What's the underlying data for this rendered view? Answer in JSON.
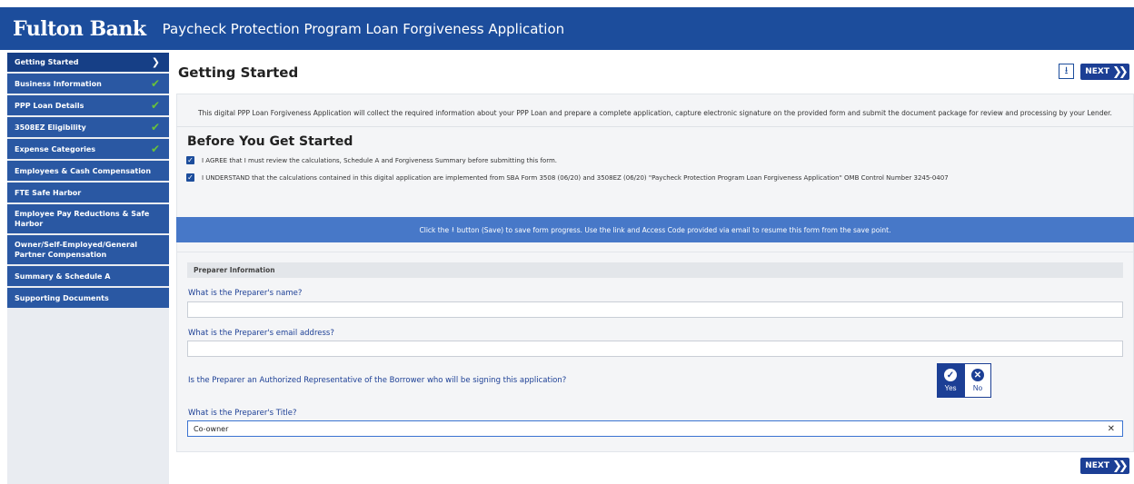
{
  "header": {
    "brand": "Fulton Bank",
    "title": "Paycheck Protection Program Loan Forgiveness Application"
  },
  "sidebar": {
    "items": [
      {
        "label": "Getting Started",
        "state": "active"
      },
      {
        "label": "Business Information",
        "state": "complete"
      },
      {
        "label": "PPP Loan Details",
        "state": "complete"
      },
      {
        "label": "3508EZ Eligibility",
        "state": "complete"
      },
      {
        "label": "Expense Categories",
        "state": "complete"
      },
      {
        "label": "Employees & Cash Compensation",
        "state": "incomplete"
      },
      {
        "label": "FTE Safe Harbor",
        "state": "incomplete"
      },
      {
        "label": "Employee Pay Reductions & Safe Harbor",
        "state": "incomplete"
      },
      {
        "label": "Owner/Self-Employed/General Partner Compensation",
        "state": "incomplete"
      },
      {
        "label": "Summary & Schedule A",
        "state": "incomplete"
      },
      {
        "label": "Supporting Documents",
        "state": "incomplete"
      }
    ]
  },
  "main": {
    "page_title": "Getting Started",
    "next_label": "NEXT",
    "intro": "This digital PPP Loan Forgiveness Application will collect the required information about your PPP Loan and prepare a complete application, capture electronic signature on the provided form and submit the document package for review and processing by your Lender.",
    "before_title": "Before You Get Started",
    "agree_1": "I AGREE that I must review the calculations, Schedule A and Forgiveness Summary before submitting this form.",
    "agree_2": "I UNDERSTAND that the calculations contained in this digital application are implemented from SBA Form 3508 (06/20) and 3508EZ (06/20) \"Paycheck Protection Program Loan Forgiveness Application\" OMB Control Number 3245-0407",
    "info_bar": {
      "prefix": "Click the",
      "suffix": "button (Save) to save form progress.  Use the link and Access Code provided via email to resume this form from the save point."
    }
  },
  "form": {
    "section_title": "Preparer Information",
    "q_name": "What is the Preparer's name?",
    "name_value": "",
    "q_email": "What is the Preparer's email address?",
    "email_value": "",
    "q_authorized": "Is the Preparer an Authorized Representative of the Borrower who will be signing this application?",
    "yes_label": "Yes",
    "no_label": "No",
    "selected": "Yes",
    "q_title": "What is the Preparer's Title?",
    "title_value": "Co-owner"
  },
  "colors": {
    "header_bg": "#1c4d9c",
    "sidebar_item_bg": "#2a58a3",
    "accent": "#1c3f95",
    "check_green": "#68c23a",
    "info_bar_bg": "#4778c8"
  },
  "icons": {
    "save": "download-icon",
    "complete": "checkmark-icon",
    "active": "chevron-right-icon",
    "next": "double-chevron-right-icon"
  }
}
